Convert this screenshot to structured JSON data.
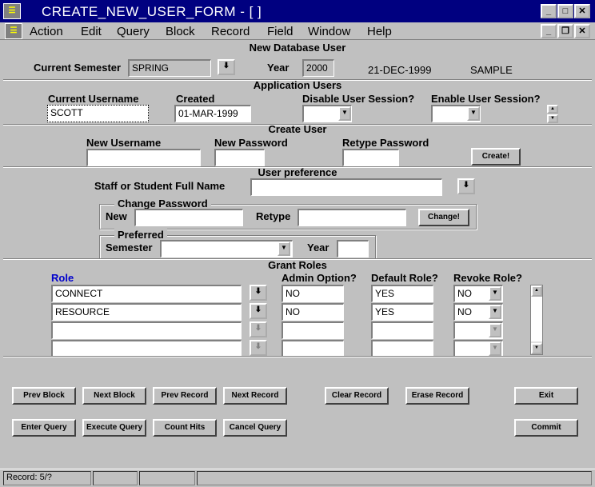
{
  "window": {
    "title": "CREATE_NEW_USER_FORM - [ ]"
  },
  "menu": [
    "Action",
    "Edit",
    "Query",
    "Block",
    "Record",
    "Field",
    "Window",
    "Help"
  ],
  "database_user": {
    "section_title": "New Database User",
    "semester_label": "Current Semester",
    "semester_value": "SPRING",
    "year_label": "Year",
    "year_value": "2000",
    "date": "21-DEC-1999",
    "db_name": "SAMPLE"
  },
  "app_users": {
    "section_title": "Application Users",
    "username_label": "Current Username",
    "username_value": "SCOTT",
    "created_label": "Created",
    "created_value": "01-MAR-1999",
    "disable_label": "Disable User Session?",
    "disable_value": "",
    "enable_label": "Enable User Session?",
    "enable_value": ""
  },
  "create_user": {
    "section_title": "Create User",
    "new_username_label": "New Username",
    "new_username_value": "",
    "new_password_label": "New Password",
    "new_password_value": "",
    "retype_label": "Retype Password",
    "retype_value": "",
    "create_button": "Create!"
  },
  "preference": {
    "section_title": "User preference",
    "fullname_label": "Staff or Student Full Name",
    "fullname_value": "",
    "change_pw_title": "Change Password",
    "new_label": "New",
    "retype_label": "Retype",
    "change_button": "Change!",
    "preferred_title": "Preferred",
    "semester_label": "Semester",
    "year_label": "Year"
  },
  "grant_roles": {
    "section_title": "Grant Roles",
    "col_role": "Role",
    "col_admin": "Admin Option?",
    "col_default": "Default Role?",
    "col_revoke": "Revoke Role?",
    "rows": [
      {
        "role": "CONNECT",
        "admin": "NO",
        "default": "YES",
        "revoke": "NO"
      },
      {
        "role": "RESOURCE",
        "admin": "NO",
        "default": "YES",
        "revoke": "NO"
      },
      {
        "role": "",
        "admin": "",
        "default": "",
        "revoke": ""
      },
      {
        "role": "",
        "admin": "",
        "default": "",
        "revoke": ""
      }
    ]
  },
  "buttons": {
    "prev_block": "Prev Block",
    "next_block": "Next Block",
    "prev_record": "Prev Record",
    "next_record": "Next Record",
    "clear_record": "Clear Record",
    "erase_record": "Erase Record",
    "exit": "Exit",
    "enter_query": "Enter Query",
    "execute_query": "Execute Query",
    "count_hits": "Count Hits",
    "cancel_query": "Cancel Query",
    "commit": "Commit"
  },
  "status": {
    "record": "Record: 5/?"
  },
  "colors": {
    "titlebar": "#000080",
    "role_header": "#0000cc"
  }
}
